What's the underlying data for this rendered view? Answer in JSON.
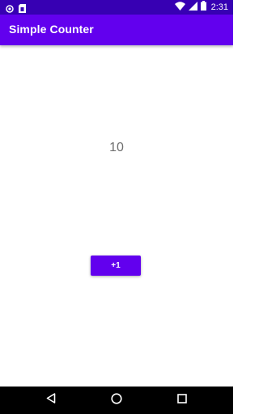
{
  "status_bar": {
    "time": "2:31",
    "icons": [
      "notification-icon",
      "sim-card-icon",
      "wifi-icon",
      "cell-signal-icon",
      "battery-icon"
    ]
  },
  "app_bar": {
    "title": "Simple Counter"
  },
  "counter": {
    "value": "10"
  },
  "increment_button": {
    "label": "+1"
  },
  "nav_bar": {
    "icons": [
      "back-icon",
      "home-icon",
      "recents-icon"
    ]
  },
  "colors": {
    "status_bar": "#3700b3",
    "primary": "#6200ee",
    "counter_text": "#6e6e6e",
    "nav_bar": "#000000"
  }
}
